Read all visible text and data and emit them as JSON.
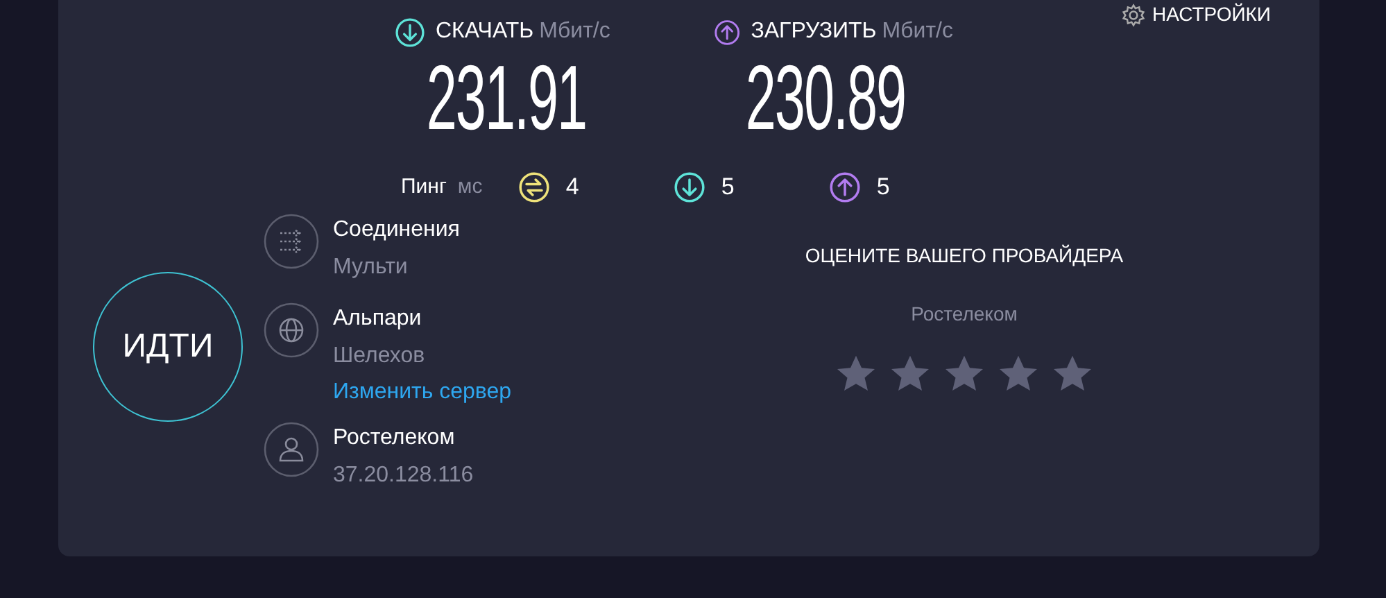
{
  "settings": {
    "label": "НАСТРОЙКИ"
  },
  "speeds": [
    {
      "kind": "download",
      "label": "СКАЧАТЬ",
      "unit": "Мбит/с",
      "value": "231.91"
    },
    {
      "kind": "upload",
      "label": "ЗАГРУЗИТЬ",
      "unit": "Мбит/с",
      "value": "230.89"
    }
  ],
  "ping": {
    "label": "Пинг",
    "unit": "мс",
    "values": [
      {
        "kind": "jitter",
        "value": "4"
      },
      {
        "kind": "download",
        "value": "5"
      },
      {
        "kind": "upload",
        "value": "5"
      }
    ]
  },
  "go_button": "ИДТИ",
  "info": [
    {
      "kind": "connections",
      "title": "Соединения",
      "subtitle": "Мульти"
    },
    {
      "kind": "server",
      "title": "Альпари",
      "subtitle": "Шелехов",
      "link": "Изменить сервер"
    },
    {
      "kind": "provider",
      "title": "Ростелеком",
      "subtitle": "37.20.128.116"
    }
  ],
  "rating": {
    "title": "ОЦЕНИТЕ ВАШЕГО ПРОВАЙДЕРА",
    "provider": "Ростелеком"
  }
}
